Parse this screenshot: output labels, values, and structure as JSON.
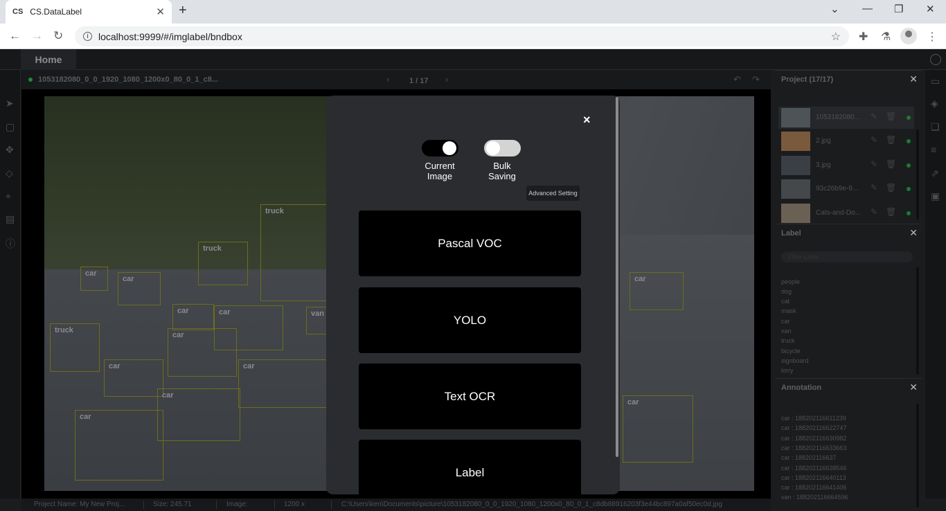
{
  "browser": {
    "tab_icon": "CS",
    "tab_title": "CS.DataLabel",
    "url": "localhost:9999/#/imglabel/bndbox"
  },
  "app": {
    "home_label": "Home",
    "file_title": "1053182080_0_0_1920_1080_1200x0_80_0_1_c8...",
    "pager": "1 / 17"
  },
  "image_boxes": [
    {
      "label": "truck"
    },
    {
      "label": "truck"
    },
    {
      "label": "car"
    },
    {
      "label": "car"
    },
    {
      "label": "car"
    },
    {
      "label": "car"
    },
    {
      "label": "van"
    },
    {
      "label": "truck"
    },
    {
      "label": "car"
    },
    {
      "label": "car"
    },
    {
      "label": "car"
    },
    {
      "label": "car"
    },
    {
      "label": "car"
    },
    {
      "label": "car"
    },
    {
      "label": "car"
    }
  ],
  "status_bar": {
    "project": "Project Name: My New Proj...",
    "size": "Size: 245.71",
    "image": "Image:",
    "dims": "1200 x",
    "path": "C:\\Users\\ken\\Documents\\picture\\1053182080_0_0_1920_1080_1200x0_80_0_1_c8db88916203f3e44bc897a0af50ec0d.jpg"
  },
  "project_panel": {
    "title": "Project (17/17)",
    "items": [
      {
        "name": "1053182080..."
      },
      {
        "name": "2.jpg"
      },
      {
        "name": "3.jpg"
      },
      {
        "name": "93c26b9e-9..."
      },
      {
        "name": "Cats-and-Do..."
      }
    ]
  },
  "label_panel": {
    "title": "Label",
    "search_placeholder": "Filter Label",
    "labels": [
      "people",
      "dog",
      "cat",
      "mask",
      "car",
      "van",
      "truck",
      "bicycle",
      "signboard",
      "lorry"
    ]
  },
  "annotation_panel": {
    "title": "Annotation",
    "items": [
      "car : 188202116611239",
      "car : 188202116622747",
      "car : 188202116630982",
      "car : 188202116633663",
      "car : 188202116637",
      "car : 188202116638546",
      "car : 188202116640113",
      "car : 188202116641406",
      "van : 188202116664596"
    ]
  },
  "modal": {
    "close": "×",
    "toggle_current": {
      "label_line1": "Current",
      "label_line2": "Image",
      "on": true
    },
    "toggle_bulk": {
      "label_line1": "Bulk",
      "label_line2": "Saving",
      "on": false
    },
    "advanced": "Advanced Setting",
    "buttons": [
      "Pascal VOC",
      "YOLO",
      "Text OCR",
      "Label"
    ]
  },
  "colors": {
    "bbox": "#6e6d1d",
    "status_dot": "#1c7a33"
  }
}
